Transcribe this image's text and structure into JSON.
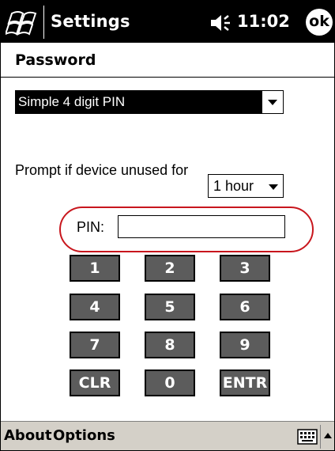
{
  "titlebar": {
    "title": "Settings",
    "time": "11:02",
    "ok_label": "ok",
    "icons": {
      "start": "windows-flag-icon",
      "volume": "speaker-volume-icon"
    }
  },
  "section": {
    "title": "Password"
  },
  "password_type": {
    "selected": "Simple 4 digit PIN"
  },
  "prompt": {
    "label": "Prompt if device unused for",
    "selected": "1 hour"
  },
  "pin": {
    "label": "PIN:",
    "value": ""
  },
  "keypad": {
    "keys": [
      "1",
      "2",
      "3",
      "4",
      "5",
      "6",
      "7",
      "8",
      "9",
      "CLR",
      "0",
      "ENTR"
    ]
  },
  "menubar": {
    "about": "About",
    "options": "Options",
    "icons": {
      "keyboard": "keyboard-icon",
      "up": "up-arrow-icon"
    }
  },
  "colors": {
    "titlebar_bg": "#000000",
    "key_bg": "#5c5c5c",
    "highlight_oval": "#c8161d",
    "menubar_bg": "#d4d0c8"
  }
}
